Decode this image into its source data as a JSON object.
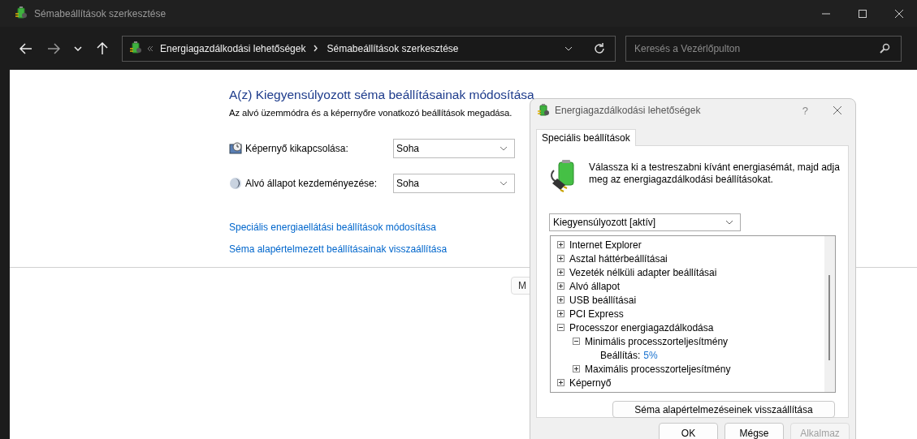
{
  "window": {
    "title": "Sémabeállítások szerkesztése"
  },
  "address_bar": {
    "crumbs": [
      "Energiagazdálkodási lehetőségek",
      "Sémabeállítások szerkesztése"
    ]
  },
  "search": {
    "placeholder": "Keresés a Vezérlőpulton"
  },
  "page": {
    "heading": "A(z) Kiegyensúlyozott séma beállításainak módosítása",
    "description": "Az alvó üzemmódra és a képernyőre vonatkozó beállítások megadása.",
    "settings": [
      {
        "kind": "display",
        "label": "Képernyő kikapcsolása:",
        "value": "Soha"
      },
      {
        "kind": "sleep",
        "label": "Alvó állapot kezdeményezése:",
        "value": "Soha"
      }
    ],
    "links": [
      "Speciális energiaellátási beállítások módosítása",
      "Séma alapértelmezett beállításainak visszaállítása"
    ],
    "button": "M"
  },
  "dialog": {
    "title": "Energiagazdálkodási lehetőségek",
    "help": "?",
    "tabs": [
      {
        "label": "Speciális beállítások",
        "selected": true
      }
    ],
    "intro": "Válassza ki a testreszabni kívánt energiasémát, majd adja meg az energiagazdálkodási beállításokat.",
    "plan": "Kiegyensúlyozott [aktív]",
    "tree": [
      {
        "kind": "group",
        "label": "Internet Explorer",
        "expanded": false
      },
      {
        "kind": "group",
        "label": "Asztal háttérbeállításai",
        "expanded": false
      },
      {
        "kind": "group",
        "label": "Vezeték nélküli adapter beállításai",
        "expanded": false
      },
      {
        "kind": "group",
        "label": "Alvó állapot",
        "expanded": false
      },
      {
        "kind": "group",
        "label": "USB beállításai",
        "expanded": false
      },
      {
        "kind": "group",
        "label": "PCI Express",
        "expanded": false
      },
      {
        "kind": "group",
        "label": "Processzor energiagazdálkodása",
        "expanded": true,
        "children": [
          {
            "kind": "group",
            "label": "Minimális processzorteljesítmény",
            "expanded": true,
            "children": [
              {
                "kind": "setting",
                "label": "Beállítás:",
                "value": "5%"
              }
            ]
          },
          {
            "kind": "group",
            "label": "Maximális processzorteljesítmény",
            "expanded": false
          }
        ]
      },
      {
        "kind": "group",
        "label": "Képernyő",
        "expanded": false
      }
    ],
    "restore_button": "Séma alapértelmezéseinek visszaállítása",
    "buttons": [
      {
        "label": "OK",
        "disabled": false
      },
      {
        "label": "Mégse",
        "disabled": false
      },
      {
        "label": "Alkalmaz",
        "disabled": true
      }
    ]
  }
}
